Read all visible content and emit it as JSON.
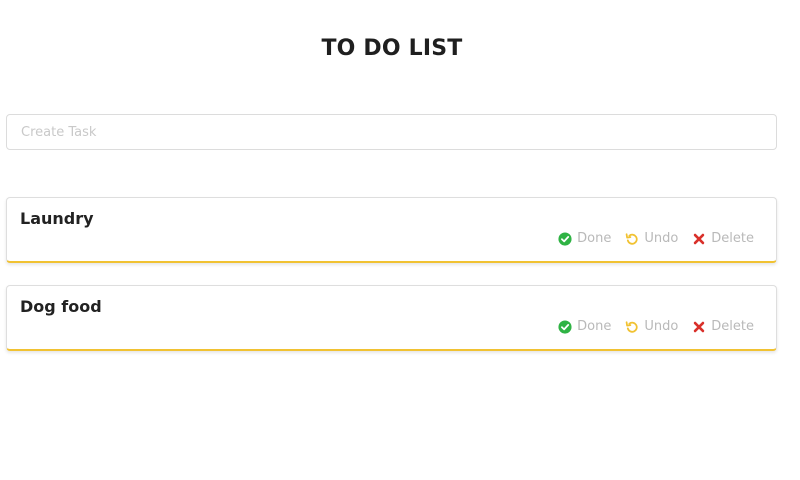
{
  "header": {
    "title": "TO DO LIST"
  },
  "create": {
    "placeholder": "Create Task",
    "value": ""
  },
  "colors": {
    "done": "#2fb344",
    "undo": "#f1c232",
    "delete": "#d9302a",
    "card_accent": "#f1c232",
    "action_text": "#b9b9b9"
  },
  "tasks": [
    {
      "title": "Laundry",
      "actions": {
        "done_label": "Done",
        "undo_label": "Undo",
        "delete_label": "Delete"
      }
    },
    {
      "title": "Dog food",
      "actions": {
        "done_label": "Done",
        "undo_label": "Undo",
        "delete_label": "Delete"
      }
    }
  ],
  "icons": {
    "done": "check-circle-icon",
    "undo": "undo-icon",
    "delete": "close-icon"
  }
}
